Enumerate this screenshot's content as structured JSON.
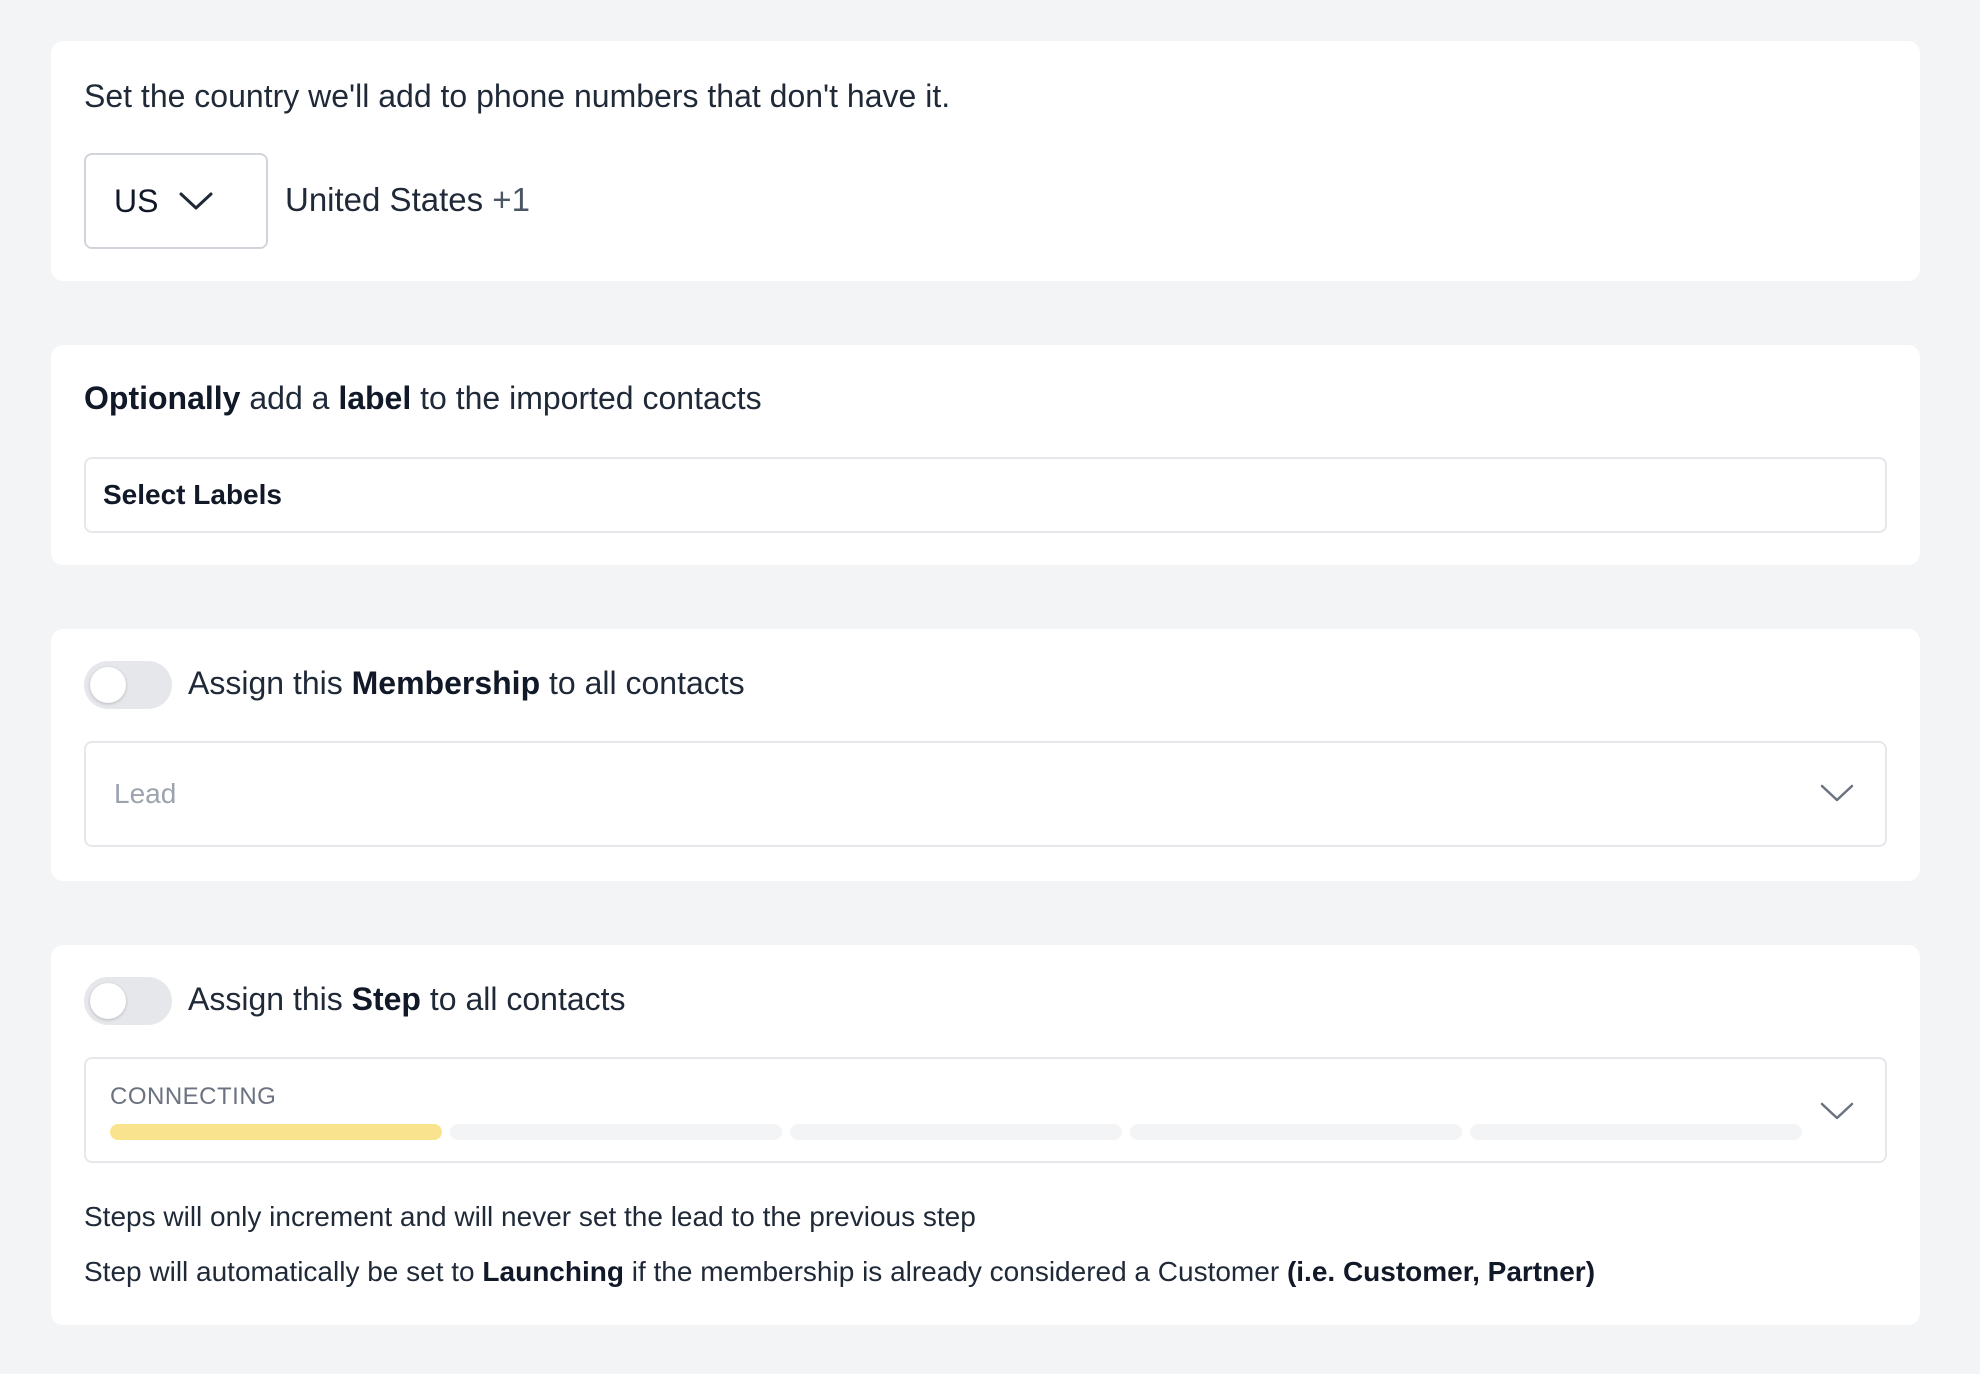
{
  "country_section": {
    "description": "Set the country we'll add to phone numbers that don't have it.",
    "selected_code": "US",
    "country_name": "United States",
    "dial_code": "+1"
  },
  "label_section": {
    "desc_bold_1": "Optionally",
    "desc_text_1": " add a ",
    "desc_bold_2": "label",
    "desc_text_2": " to the imported contacts",
    "input_label": "Select Labels"
  },
  "membership_section": {
    "toggle_on": false,
    "toggle_text_1": "Assign this ",
    "toggle_bold": "Membership",
    "toggle_text_2": " to all contacts",
    "selected_value": "Lead"
  },
  "step_section": {
    "toggle_on": false,
    "toggle_text_1": "Assign this ",
    "toggle_bold": "Step",
    "toggle_text_2": " to all contacts",
    "selected_step": "CONNECTING",
    "step_count": 5,
    "active_steps": 1,
    "active_color": "#fae38f",
    "note_1": "Steps will only increment and will never set the lead to the previous step",
    "note_2_text_1": "Step will automatically be set to ",
    "note_2_bold_1": "Launching",
    "note_2_text_2": " if the membership is already considered a Customer ",
    "note_2_bold_2": "(i.e. Customer, Partner)"
  }
}
